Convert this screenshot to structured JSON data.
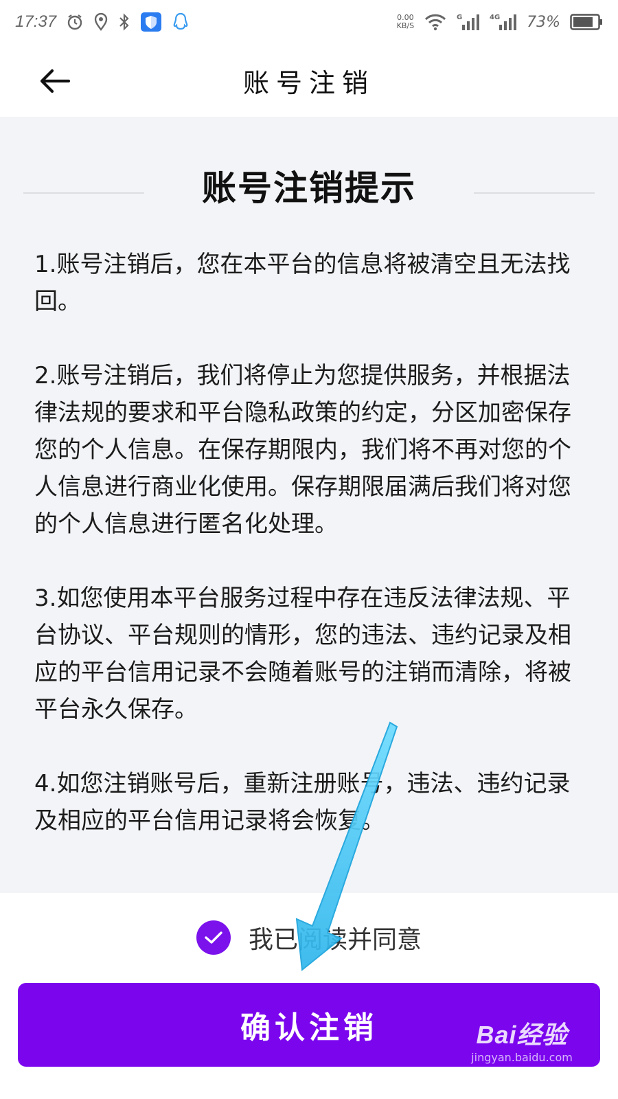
{
  "status_bar": {
    "time": "17:37",
    "net_speed_value": "0.00",
    "net_speed_unit": "KB/S",
    "signal_1_label": "G",
    "signal_2_label": "4G",
    "battery": "73%"
  },
  "header": {
    "title": "账号注销"
  },
  "notice": {
    "title": "账号注销提示",
    "paragraphs": [
      "1.账号注销后，您在本平台的信息将被清空且无法找回。",
      "2.账号注销后，我们将停止为您提供服务，并根据法律法规的要求和平台隐私政策的约定，分区加密保存您的个人信息。在保存期限内，我们将不再对您的个人信息进行商业化使用。保存期限届满后我们将对您的个人信息进行匿名化处理。",
      "3.如您使用本平台服务过程中存在违反法律法规、平台协议、平台规则的情形，您的违法、违约记录及相应的平台信用记录不会随着账号的注销而清除，将被平台永久保存。",
      "4.如您注销账号后，重新注册账号，违法、违约记录及相应的平台信用记录将会恢复。"
    ]
  },
  "agreement": {
    "label": "我已阅读并同意",
    "checked": true
  },
  "confirm_button": {
    "label": "确认注销"
  },
  "watermark": {
    "brand": "Bai经验",
    "url": "jingyan.baidu.com"
  },
  "colors": {
    "accent": "#7b06ee",
    "content_bg": "#f3f4f7",
    "annotation_arrow": "#3cc4f0"
  },
  "icons": {
    "back": "arrow-left-icon",
    "alarm": "alarm-icon",
    "location": "location-icon",
    "bluetooth": "bluetooth-icon",
    "shield": "shield-icon",
    "qq": "qq-icon",
    "wifi": "wifi-icon",
    "battery": "battery-icon",
    "check": "check-icon"
  }
}
